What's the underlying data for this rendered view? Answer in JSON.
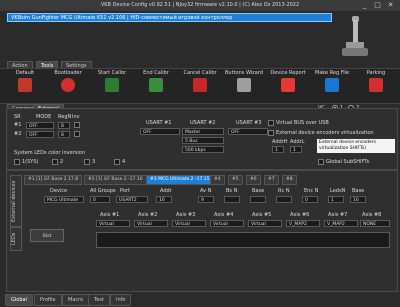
{
  "window": {
    "title": "VKB Device Config v0.92.51 | NJoy32 firmware v2.10.0 | (C) Alex Oz 2013-2022",
    "minimize": "_",
    "maximize": "□",
    "close": "✕"
  },
  "device_bar": {
    "text": "VKBsim GunFighter MCG Ultimate K51 v2.106 | HID-совместимый игровой контроллер"
  },
  "top_tabs": [
    {
      "label": "Action"
    },
    {
      "label": "Tools"
    },
    {
      "label": "Settings"
    }
  ],
  "toolbar": [
    {
      "label": "Default"
    },
    {
      "label": "Bootloader"
    },
    {
      "label": "Start Calibr"
    },
    {
      "label": "End Calibr"
    },
    {
      "label": "Cancel Calibr"
    },
    {
      "label": "Buttons Wizard"
    },
    {
      "label": "Device Report"
    },
    {
      "label": "Make Reg File"
    },
    {
      "label": "Parking"
    }
  ],
  "sub_tabs": [
    {
      "label": "Common"
    },
    {
      "label": "External"
    }
  ],
  "vc": {
    "label": "VC",
    "opt1": "1",
    "opt2": "2"
  },
  "sr": {
    "headers": {
      "sr": "SR",
      "mode": "MODE",
      "regn": "RegN",
      "inv": "Inv"
    },
    "rows": [
      {
        "label": "#1",
        "mode": "OFF",
        "regn": "8"
      },
      {
        "label": "#2",
        "mode": "OFF",
        "regn": "8"
      }
    ]
  },
  "usart": {
    "headers": [
      "USART #1",
      "USART #2",
      "USART #3"
    ],
    "row1": [
      "OFF",
      "Master",
      "OFF"
    ],
    "row2": [
      "",
      "5 Bus",
      ""
    ],
    "row3": [
      "",
      "500 kbps",
      ""
    ]
  },
  "leds": {
    "label": "System LEDs color inversion",
    "items": [
      "1(SYS)",
      "2",
      "3",
      "4"
    ]
  },
  "virtual_bus": {
    "virtual_bus_label": "Virtual BUS over USB",
    "ext_virt_label": "External device encoders virtualization",
    "addr1_label": "AddrH",
    "addr1": "1",
    "addr2_label": "AddrL",
    "addr2": "1",
    "global_label": "Global SubSHIFTs"
  },
  "tooltip": {
    "text": "External device encoders virtualization SHIFTs)"
  },
  "side_tabs": {
    "external": "External devices",
    "leds": "LEDs"
  },
  "device_tabs": [
    {
      "label": "#1 [1] GF Base 2 17.8"
    },
    {
      "label": "#2 [1] GF Base 2 -17.10"
    },
    {
      "label": "#3 MCG Ultimate 2 -17.15"
    },
    {
      "label": "#4"
    },
    {
      "label": "#5"
    },
    {
      "label": "#6"
    },
    {
      "label": "#7"
    },
    {
      "label": "#8"
    }
  ],
  "device_row": {
    "headers": {
      "device": "Device",
      "all_groups": "All Groups",
      "port": "Port",
      "addr": "Addr",
      "av": "Av N",
      "bs": "Bs N",
      "base": "Base",
      "rc": "Rc N",
      "enc": "Enc N",
      "leds": "LedsN",
      "base2": "Base"
    },
    "device": "MCG Ultimate",
    "all_groups": "0",
    "port": "USART2",
    "addr": "16",
    "av": "9",
    "bs": "",
    "base": "",
    "rc": "",
    "enc": "0",
    "leds": "1",
    "base2": "16"
  },
  "axes": {
    "labels": [
      "Axis #1",
      "Axis #2",
      "Axis #3",
      "Axis #4",
      "Axis #5",
      "Axis #6",
      "Axis #7",
      "Axis #8"
    ],
    "values": [
      "Virtual",
      "Virtual",
      "Virtual",
      "Virtual",
      "Virtual",
      "V_MAP2",
      "V_MAP2",
      "NONE"
    ]
  },
  "stst_button": "Stst",
  "bottom_tabs": [
    {
      "label": "Global"
    },
    {
      "label": "Profile"
    },
    {
      "label": "Macro"
    },
    {
      "label": "Test"
    },
    {
      "label": "Info"
    }
  ],
  "colors": {
    "accent": "#1e7fd6",
    "bg": "#2b2b2b",
    "panel": "#2f2f2f"
  }
}
